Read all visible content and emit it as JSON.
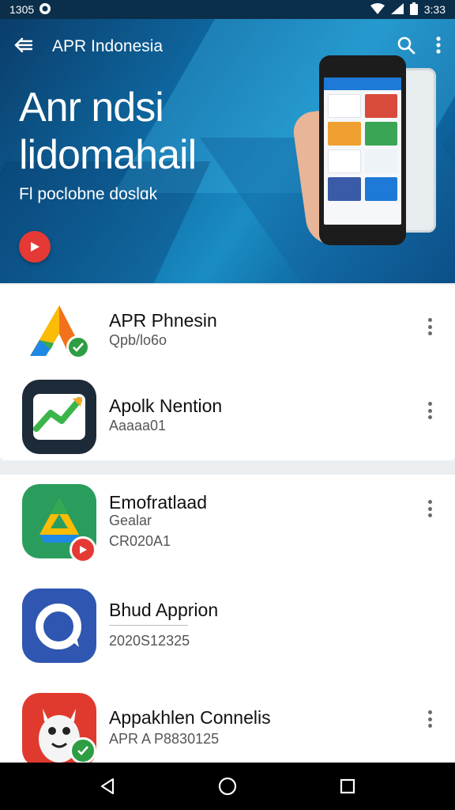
{
  "status_bar": {
    "time_left": "1305",
    "time_right": "3:33"
  },
  "app_bar": {
    "title": "APR Indonesia"
  },
  "hero": {
    "title_line1": "Anr ndsi",
    "title_line2": "lidomahail",
    "subtitle": "Fl poclobne doslɑk"
  },
  "list1": [
    {
      "name": "APR Phnesin",
      "sub": "Qpb/lo6o",
      "icon": "affiliate-triangle-icon"
    },
    {
      "name": "Apolk Nention",
      "sub": "Aaaaa01",
      "icon": "chart-trend-icon"
    }
  ],
  "list2": [
    {
      "name": "Emofratlaad",
      "sub": "Gealar",
      "sub2": "CR020A1",
      "icon": "drive-triangle-icon"
    },
    {
      "name": "Bhud Apprion",
      "sub": "2020S12325",
      "icon": "chat-bubble-icon"
    },
    {
      "name": "Appakhlen Connelis",
      "sub": "APR A P8830125",
      "icon": "monster-mascot-icon"
    }
  ],
  "colors": {
    "hero_dark": "#0a3d6b",
    "hero_light": "#1a8cc4",
    "accent_red": "#e53935",
    "check_green": "#2e9e44"
  }
}
